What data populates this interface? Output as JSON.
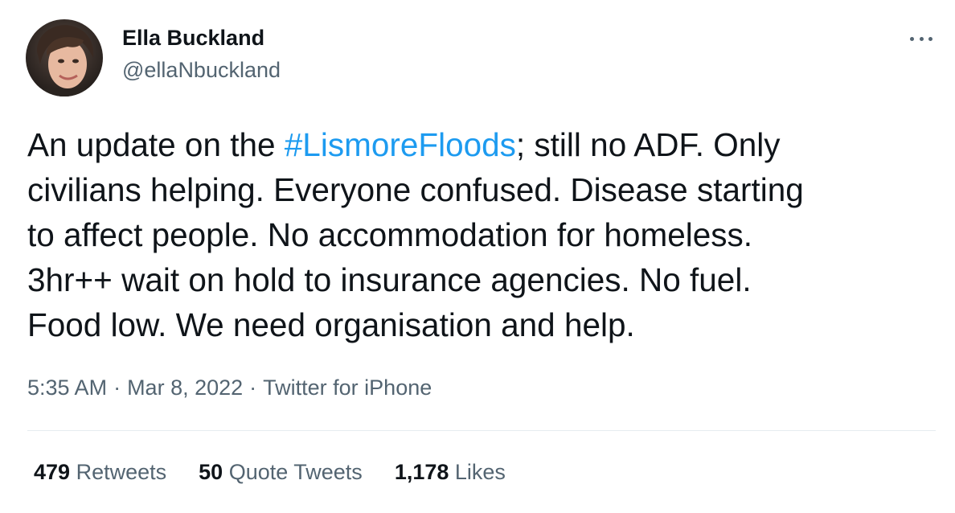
{
  "author": {
    "display_name": "Ella Buckland",
    "handle": "@ellaNbuckland"
  },
  "tweet": {
    "line1_before": "An update on the ",
    "hashtag": "#LismoreFloods",
    "line1_after": "; still no ADF. Only",
    "line2": "civilians helping. Everyone confused. Disease starting",
    "line3": "to affect people. No accommodation for homeless.",
    "line4": "3hr++ wait on hold to insurance agencies. No fuel.",
    "line5": "Food low. We need organisation and help."
  },
  "meta": {
    "time": "5:35 AM",
    "separator": "·",
    "date": "Mar 8, 2022",
    "source": "Twitter for iPhone"
  },
  "stats": {
    "retweets_count": "479",
    "retweets_label": "Retweets",
    "quote_count": "50",
    "quote_label": "Quote Tweets",
    "likes_count": "1,178",
    "likes_label": "Likes"
  },
  "icons": {
    "more": "more-dots-icon",
    "avatar": "avatar"
  },
  "colors": {
    "hashtag": "#1d9bf0",
    "secondary_text": "#536471",
    "primary_text": "#0f1419"
  }
}
